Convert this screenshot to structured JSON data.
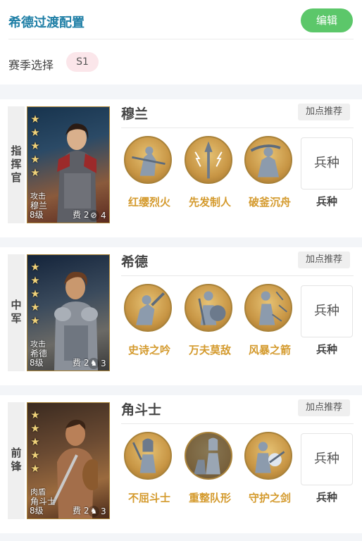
{
  "header": {
    "title": "希德过渡配置",
    "edit_label": "编辑",
    "season_label": "赛季选择",
    "season_value": "S1"
  },
  "cards": [
    {
      "role": "指挥官",
      "hero_name": "穆兰",
      "portrait_type": "攻击",
      "portrait_name": "穆兰",
      "level": "8级",
      "cost": "费 2",
      "cost_icon": "no-bow-icon",
      "count": "4",
      "stars": 5,
      "recommend_label": "加点推荐",
      "skills": [
        "红缨烈火",
        "先发制人",
        "破釜沉舟"
      ],
      "skill_icons": [
        "warrior-spear-icon",
        "lightning-spear-icon",
        "sword-warrior-icon"
      ],
      "troop_box": "兵种",
      "troop_label": "兵种"
    },
    {
      "role": "中军",
      "hero_name": "希德",
      "portrait_type": "攻击",
      "portrait_name": "希德",
      "level": "8级",
      "cost": "费 2",
      "cost_icon": "horse-icon",
      "count": "3",
      "stars": 5,
      "recommend_label": "加点推荐",
      "skills": [
        "史诗之吟",
        "万夫莫敌",
        "风暴之箭"
      ],
      "skill_icons": [
        "bard-icon",
        "shield-warrior-icon",
        "archer-icon"
      ],
      "troop_box": "兵种",
      "troop_label": "兵种"
    },
    {
      "role": "前锋",
      "hero_name": "角斗士",
      "portrait_type": "肉盾",
      "portrait_name": "角斗士",
      "level": "8级",
      "cost": "费 2",
      "cost_icon": "horse-icon",
      "count": "3",
      "stars": 5,
      "recommend_label": "加点推荐",
      "skills": [
        "不屈斗士",
        "重整队形",
        "守护之剑"
      ],
      "skill_icons": [
        "helmet-warrior-icon",
        "regroup-icon",
        "guardian-sword-icon"
      ],
      "troop_box": "兵种",
      "troop_label": "兵种"
    }
  ]
}
